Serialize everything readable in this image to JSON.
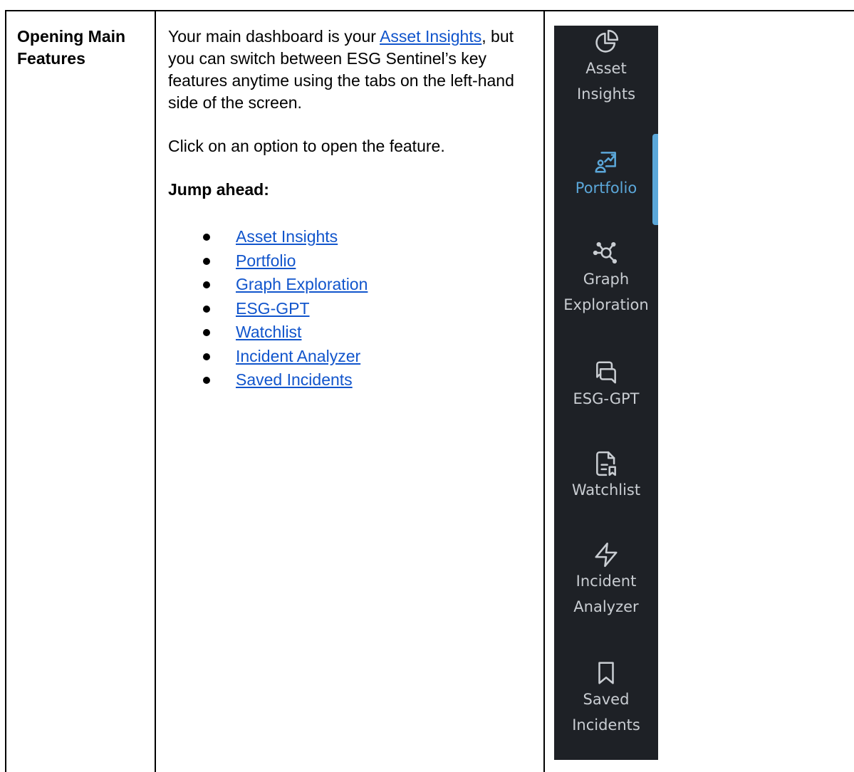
{
  "row": {
    "label_line1": "Opening Main",
    "label_line2": "Features"
  },
  "body": {
    "intro_before": "Your main dashboard is your ",
    "intro_link": "Asset Insights",
    "intro_after": ", but you can switch between ESG Sentinel’s key features anytime using the tabs on the left-hand side of the screen.",
    "instruction": "Click on an option to open the feature.",
    "jump_heading": "Jump ahead:",
    "jump_links": [
      "Asset Insights",
      "Portfolio",
      "Graph Exploration",
      "ESG-GPT",
      "Watchlist",
      "Incident Analyzer",
      "Saved Incidents"
    ]
  },
  "sidebar": {
    "active_item": "Portfolio",
    "colors": {
      "background": "#1e2126",
      "text": "#c9cdd2",
      "active": "#5ba7d9"
    },
    "items": [
      {
        "line1": "Asset",
        "line2": "Insights",
        "icon": "pie-chart-icon"
      },
      {
        "line1": "Portfolio",
        "line2": "",
        "icon": "presentation-chart-icon"
      },
      {
        "line1": "Graph",
        "line2": "Exploration",
        "icon": "network-graph-icon"
      },
      {
        "line1": "ESG-GPT",
        "line2": "",
        "icon": "chat-bubbles-icon"
      },
      {
        "line1": "Watchlist",
        "line2": "",
        "icon": "document-bookmark-icon"
      },
      {
        "line1": "Incident",
        "line2": "Analyzer",
        "icon": "lightning-icon"
      },
      {
        "line1": "Saved",
        "line2": "Incidents",
        "icon": "bookmark-icon"
      }
    ]
  }
}
